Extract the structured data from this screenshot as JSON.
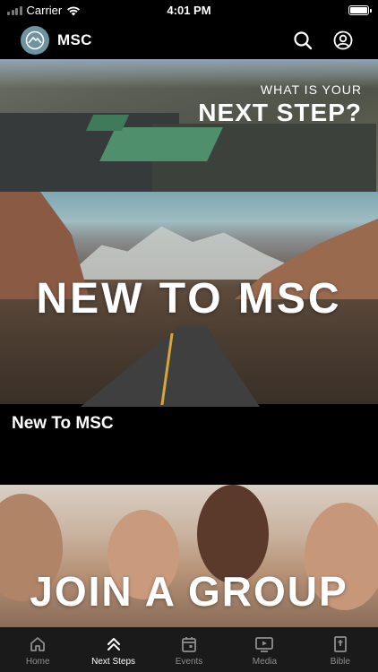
{
  "status_bar": {
    "carrier": "Carrier",
    "time": "4:01 PM"
  },
  "header": {
    "title": "MSC",
    "logo_icon": "mountain-logo-icon",
    "search_icon": "search-icon",
    "profile_icon": "profile-icon",
    "logo_color": "#6f93a1"
  },
  "hero": {
    "kicker": "WHAT IS YOUR",
    "headline": "NEXT STEP?"
  },
  "cards": [
    {
      "headline": "NEW TO MSC",
      "caption": "New To MSC"
    },
    {
      "headline": "JOIN A GROUP"
    }
  ],
  "tabs": [
    {
      "label": "Home",
      "icon": "home-icon",
      "active": false
    },
    {
      "label": "Next Steps",
      "icon": "chevron-up-double-icon",
      "active": true
    },
    {
      "label": "Events",
      "icon": "calendar-icon",
      "active": false
    },
    {
      "label": "Media",
      "icon": "play-screen-icon",
      "active": false
    },
    {
      "label": "Bible",
      "icon": "bible-icon",
      "active": false
    }
  ]
}
